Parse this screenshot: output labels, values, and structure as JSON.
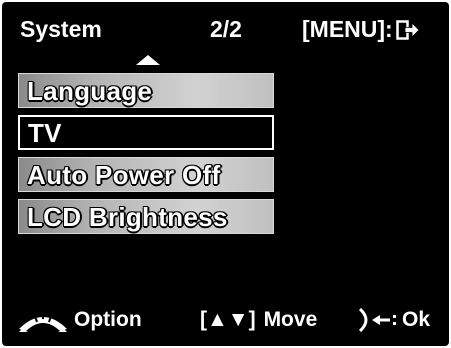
{
  "header": {
    "title": "System",
    "page": "2/2",
    "exit_label": "[MENU]:",
    "exit_icon": "exit-arrow-icon"
  },
  "menu": {
    "scroll_up_icon": "up-arrow-icon",
    "items": [
      {
        "label": "Language",
        "selected": false
      },
      {
        "label": "TV",
        "selected": true
      },
      {
        "label": "Auto Power Off",
        "selected": false
      },
      {
        "label": "LCD Brightness",
        "selected": false
      }
    ]
  },
  "footer": {
    "option_icon": "mode-wheel-icon",
    "option_label": "Option",
    "move_icon_text": "[▲▼]",
    "move_label": "Move",
    "ok_icon": "shutter-back-icon",
    "ok_label": "Ok"
  },
  "colors": {
    "background": "#000000",
    "text": "#ffffff",
    "item_gradient_start": "#8a8a8a",
    "item_gradient_end": "#d2d2d2",
    "selected_border": "#ffffff"
  }
}
